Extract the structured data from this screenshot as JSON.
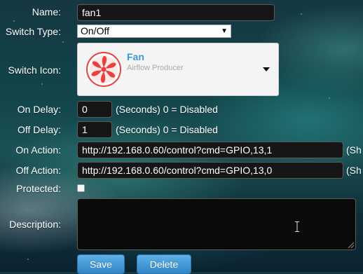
{
  "form": {
    "name": {
      "label": "Name:",
      "value": "fan1"
    },
    "switch_type": {
      "label": "Switch Type:",
      "selected": "On/Off"
    },
    "switch_icon": {
      "label": "Switch Icon:",
      "title": "Fan",
      "subtitle": "Airflow Producer",
      "icon": "fan-icon",
      "icon_color": "#e8403d",
      "title_color": "#3b9ad6"
    },
    "on_delay": {
      "label": "On Delay:",
      "value": "0",
      "hint": "(Seconds) 0 = Disabled"
    },
    "off_delay": {
      "label": "Off Delay:",
      "value": "1",
      "hint": "(Seconds) 0 = Disabled"
    },
    "on_action": {
      "label": "On Action:",
      "value": "http://192.168.0.60/control?cmd=GPIO,13,1",
      "hint": "(Sh"
    },
    "off_action": {
      "label": "Off Action:",
      "value": "http://192.168.0.60/control?cmd=GPIO,13,0",
      "hint": "(Sh"
    },
    "protected": {
      "label": "Protected:",
      "checked": false
    },
    "description": {
      "label": "Description:",
      "value": ""
    }
  },
  "buttons": {
    "save": "Save",
    "delete": "Delete",
    "color": "#3d95d3"
  }
}
